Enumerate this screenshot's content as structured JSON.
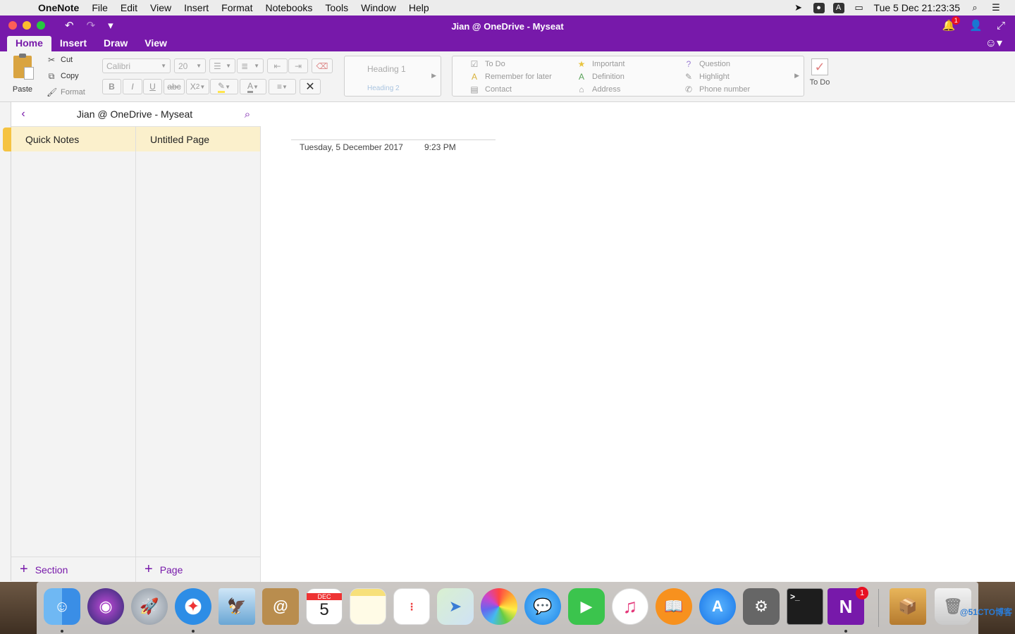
{
  "menubar": {
    "app": "OneNote",
    "items": [
      "File",
      "Edit",
      "View",
      "Insert",
      "Format",
      "Notebooks",
      "Tools",
      "Window",
      "Help"
    ],
    "clock": "Tue 5 Dec  21:23:35",
    "input_badge": "A"
  },
  "window": {
    "title": "Jian @ OneDrive - Myseat",
    "notification_count": "1",
    "tabs": [
      "Home",
      "Insert",
      "Draw",
      "View"
    ]
  },
  "ribbon": {
    "paste": "Paste",
    "cut": "Cut",
    "copy": "Copy",
    "format": "Format",
    "font_name": "Calibri",
    "font_size": "20",
    "bold": "B",
    "italic": "I",
    "underline": "U",
    "strike": "abc",
    "subscript": "X",
    "subscript_index": "2",
    "font_color": "A",
    "heading1": "Heading 1",
    "heading2": "Heading 2",
    "tags": {
      "todo": "To Do",
      "remember": "Remember for later",
      "contact": "Contact",
      "important": "Important",
      "definition": "Definition",
      "address": "Address",
      "question": "Question",
      "highlight": "Highlight",
      "phone": "Phone number",
      "remember_icon": "A",
      "definition_icon": "A"
    },
    "todo_button": "To Do"
  },
  "nav": {
    "notebook_title": "Jian @ OneDrive - Myseat",
    "section": "Quick Notes",
    "page": "Untitled Page",
    "add_section": "Section",
    "add_page": "Page"
  },
  "page": {
    "date": "Tuesday, 5 December  2017",
    "time": "9:23 PM"
  },
  "dock": {
    "calendar_month": "DEC",
    "calendar_day": "5",
    "onenote_letter": "N",
    "onenote_badge": "1",
    "terminal_prompt": ">_",
    "watermark": "@51CTO博客"
  }
}
